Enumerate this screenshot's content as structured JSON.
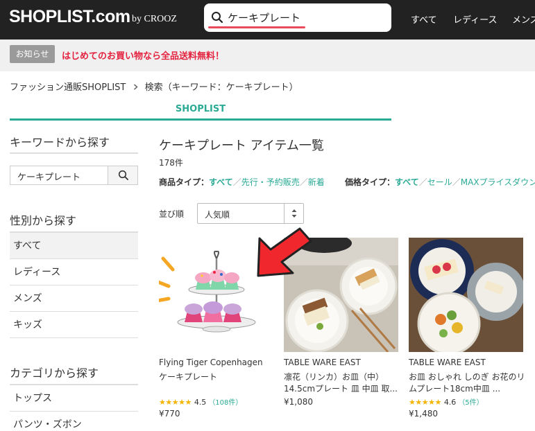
{
  "header": {
    "logo": "SHOPLIST.com",
    "logo_by": "by CROOZ",
    "search_value": "ケーキプレート",
    "nav": [
      "すべて",
      "レディース",
      "メンズ"
    ]
  },
  "notice": {
    "badge": "お知らせ",
    "text": "はじめてのお買い物なら全品送料無料！"
  },
  "breadcrumb": {
    "home": "ファッション通販SHOPLIST",
    "current": "検索（キーワード：ケーキプレート）"
  },
  "tab": {
    "label": "SHOPLIST"
  },
  "sidebar": {
    "keyword_heading": "キーワードから探す",
    "keyword_value": "ケーキプレート",
    "gender_heading": "性別から探す",
    "gender_items": [
      "すべて",
      "レディース",
      "メンズ",
      "キッズ"
    ],
    "category_heading": "カテゴリから探す",
    "category_items": [
      "トップス",
      "パンツ・ズボン"
    ]
  },
  "main": {
    "title": "ケーキプレート アイテム一覧",
    "count": "178件",
    "product_type": {
      "label": "商品タイプ：",
      "active": "すべて",
      "options": [
        "先行・予約販売",
        "新着"
      ]
    },
    "price_type": {
      "label": "価格タイプ：",
      "active": "すべて",
      "options": [
        "セール",
        "MAXプライスダウン"
      ]
    },
    "sort": {
      "label": "並び順",
      "value": "人気順"
    }
  },
  "products": [
    {
      "brand": "Flying Tiger Copenhagen",
      "name": "ケーキプレート",
      "stars": "★★★★★",
      "rating": "4.5",
      "reviews": "（108件）",
      "price": "¥770"
    },
    {
      "brand": "TABLE WARE EAST",
      "name": "凛花（リンカ）お皿（中）14.5cmプレート 皿 中皿 取...",
      "stars": "",
      "rating": "",
      "reviews": "",
      "price": "¥1,080"
    },
    {
      "brand": "TABLE WARE EAST",
      "name": "お皿 おしゃれ しのぎ お花のリムプレート18cm中皿 ...",
      "stars": "★★★★★",
      "rating": "4.6",
      "reviews": "（5件）",
      "price": "¥1,480"
    }
  ],
  "colors": {
    "accent": "#2aaa95",
    "header_bg": "#222222",
    "notice_red": "#e4223f",
    "arrow_red": "#f0282e",
    "star": "#f4b400"
  },
  "icons": [
    "search-icon",
    "chevron-right-icon",
    "sort-updown-icon",
    "pointer-arrow-icon"
  ]
}
